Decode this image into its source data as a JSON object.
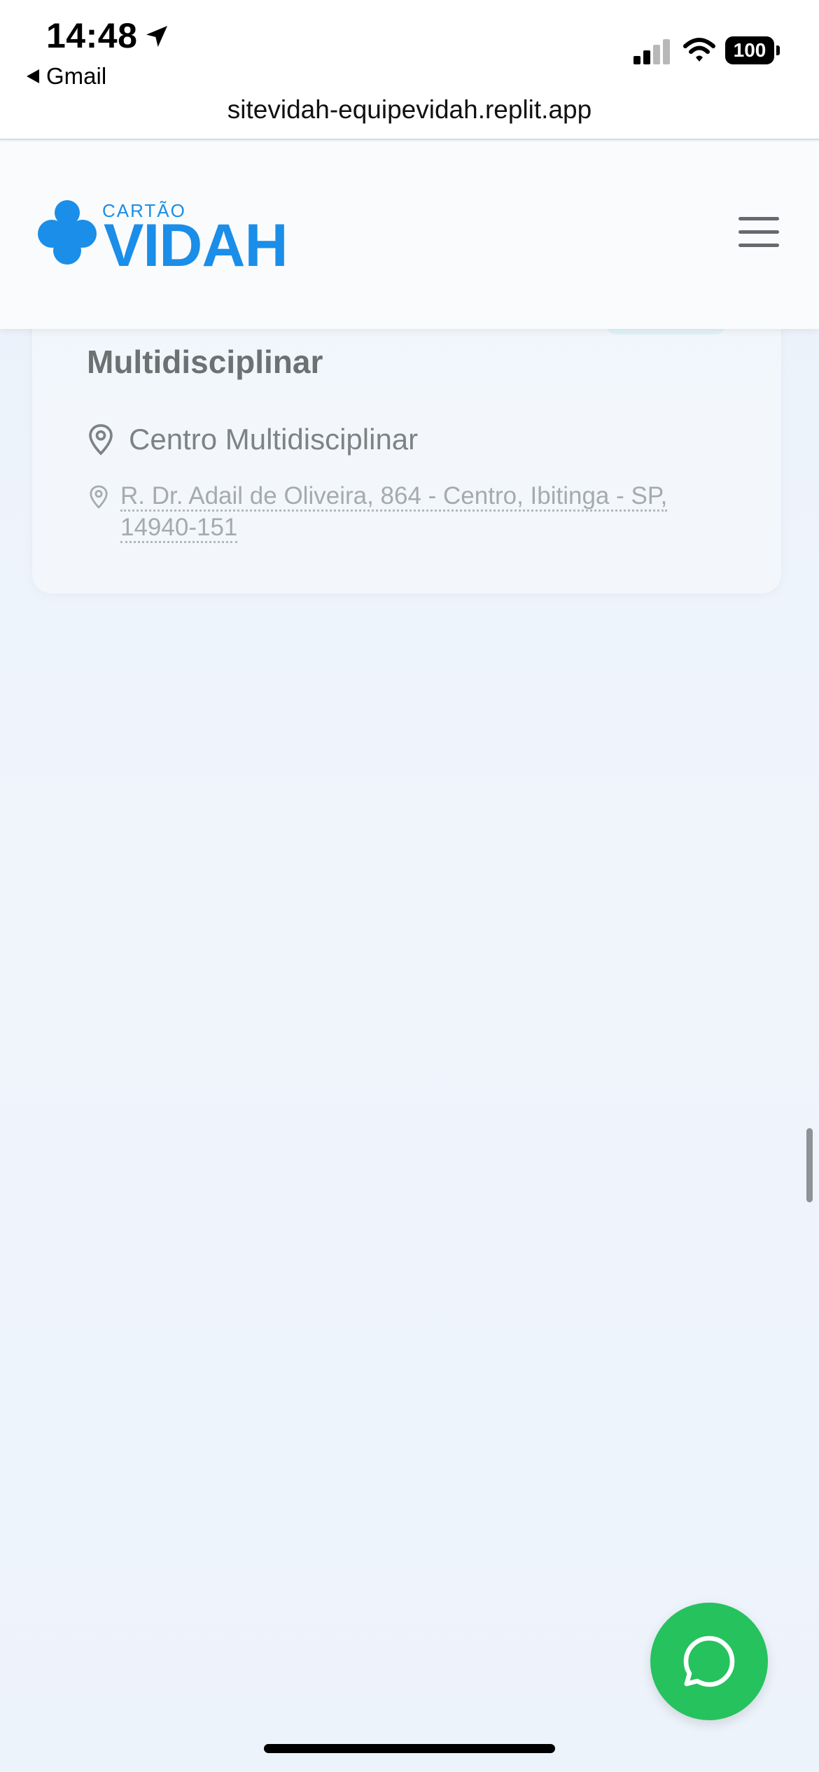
{
  "status_bar": {
    "time": "14:48",
    "back_app": "Gmail",
    "battery": "100",
    "url": "sitevidah-equipevidah.replit.app"
  },
  "header": {
    "logo_small": "CARTÃO",
    "logo_big": "VIDAH",
    "brand_color": "#1a8ee8"
  },
  "card": {
    "title": "Multidisciplinar",
    "location_name": "Centro Multidisciplinar",
    "address_line1": "R. Dr. Adail de Oliveira, 864 - Centro, Ibitinga - SP,",
    "address_line2": "14940-151"
  },
  "fab": {
    "icon": "whatsapp-icon",
    "color": "#25c25e"
  }
}
